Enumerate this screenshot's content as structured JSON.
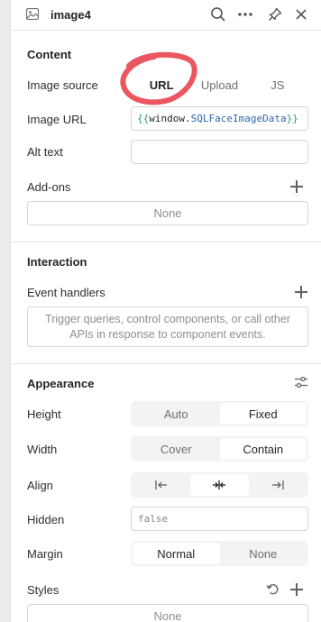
{
  "header": {
    "title": "image4",
    "icons": [
      "image-icon",
      "search-icon",
      "more-icon",
      "pin-icon",
      "close-icon"
    ]
  },
  "content": {
    "section_title": "Content",
    "image_source": {
      "label": "Image source",
      "options": [
        "URL",
        "Upload",
        "JS"
      ],
      "selected": "URL"
    },
    "image_url": {
      "label": "Image URL",
      "open": "{{",
      "object": "window.",
      "property": "SQLFaceImageData",
      "close": "}}"
    },
    "alt_text": {
      "label": "Alt text",
      "value": ""
    },
    "addons": {
      "label": "Add-ons",
      "value": "None"
    }
  },
  "interaction": {
    "section_title": "Interaction",
    "event_handlers": {
      "label": "Event handlers",
      "empty_text": "Trigger queries, control components, or call other APIs in response to component events."
    }
  },
  "appearance": {
    "section_title": "Appearance",
    "height": {
      "label": "Height",
      "options": [
        "Auto",
        "Fixed"
      ],
      "selected": "Fixed"
    },
    "width": {
      "label": "Width",
      "options": [
        "Cover",
        "Contain"
      ],
      "selected": "Contain"
    },
    "align": {
      "label": "Align",
      "options": [
        "align-left-icon",
        "align-center-icon",
        "align-right-icon"
      ],
      "selected": "align-center-icon"
    },
    "hidden": {
      "label": "Hidden",
      "value": "false"
    },
    "margin": {
      "label": "Margin",
      "options": [
        "Normal",
        "None"
      ],
      "selected": "Normal"
    },
    "styles": {
      "label": "Styles",
      "value": "None"
    }
  },
  "colors": {
    "annotation": "#e8454f",
    "brace": "#25a15c",
    "property": "#2d66b6"
  }
}
